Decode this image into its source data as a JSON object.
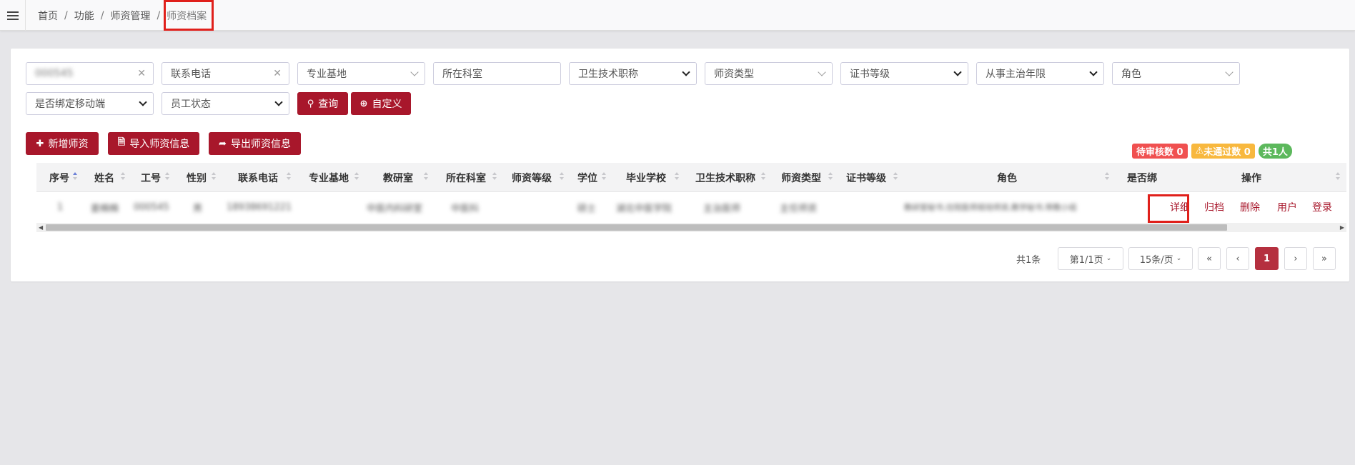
{
  "breadcrumb": {
    "home": "首页",
    "func": "功能",
    "mgmt": "师资管理",
    "current": "师资档案"
  },
  "filters": {
    "id_value": "000545",
    "phone_placeholder": "联系电话",
    "base_placeholder": "专业基地",
    "dept_placeholder": "所在科室",
    "tech_title": "卫生技术职称",
    "teacher_type": "师资类型",
    "cert_level": "证书等级",
    "years": "从事主治年限",
    "role": "角色",
    "mobile_bound": "是否绑定移动端",
    "staff_status": "员工状态",
    "query_label": "查询",
    "custom_label": "自定义"
  },
  "actions": {
    "add": "新增师资",
    "import": "导入师资信息",
    "export": "导出师资信息"
  },
  "badges": {
    "pending": "待审核数 0",
    "failed": "未通过数 0",
    "total": "共1人"
  },
  "columns": [
    "序号",
    "姓名",
    "工号",
    "性别",
    "联系电话",
    "专业基地",
    "教研室",
    "所在科室",
    "师资等级",
    "学位",
    "毕业学校",
    "卫生技术职称",
    "师资类型",
    "证书等级",
    "角色",
    "是否绑",
    "操作"
  ],
  "row": {
    "index": "1",
    "name": "姜楠楠",
    "emp_no": "000545",
    "gender": "男",
    "phone": "18938691221",
    "office": "中医内科研室",
    "dept": "中医科",
    "degree": "硕士",
    "school": "湖北中医学院",
    "tech_title": "主治医师",
    "teacher_type": "主任师资",
    "role": "教研室秘书,住院医师规培师资,教学秘书,带教小组",
    "ops": {
      "detail": "详细",
      "archive": "归档",
      "delete": "删除",
      "user": "用户",
      "login": "登录"
    }
  },
  "pagination": {
    "total": "共1条",
    "page_select": "第1/1页",
    "per_page": "15条/页",
    "first": "«",
    "prev": "‹",
    "current": "1",
    "next": "›",
    "last": "»"
  },
  "colors": {
    "accent": "#a8172b",
    "badge_red": "#f05050",
    "badge_orange": "#f8b83e",
    "badge_green": "#5cb85c",
    "highlight": "#e0201b"
  },
  "icons": {
    "menu": "hamburger-icon",
    "search": "search-icon",
    "zoom": "zoom-search-icon",
    "plus": "plus-icon",
    "file": "file-import-icon",
    "share": "share-export-icon",
    "warning": "warning-icon"
  }
}
